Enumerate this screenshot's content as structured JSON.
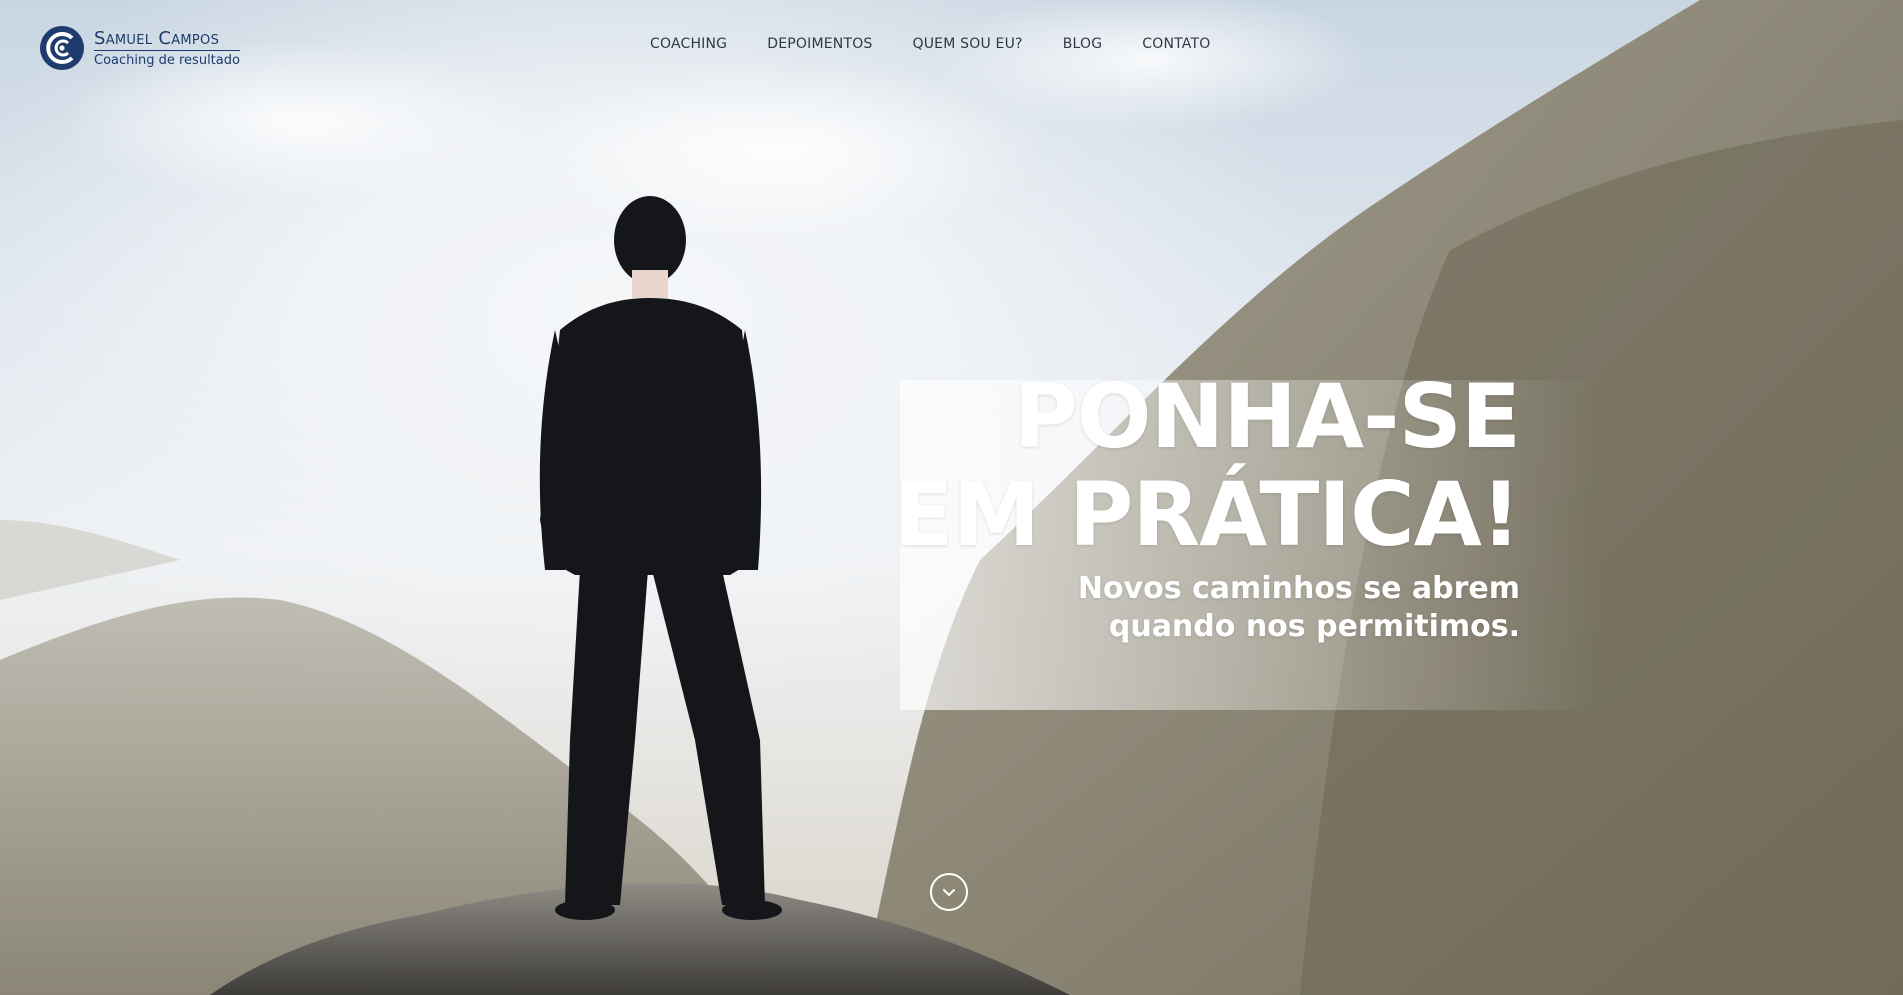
{
  "brand": {
    "name": "Samuel Campos",
    "tagline": "Coaching de resultado",
    "logo_icon": "concentric-c-logo-icon",
    "color": "#1d3b6c"
  },
  "nav": {
    "items": [
      {
        "label": "COACHING"
      },
      {
        "label": "DEPOIMENTOS"
      },
      {
        "label": "QUEM SOU EU?"
      },
      {
        "label": "BLOG"
      },
      {
        "label": "CONTATO"
      }
    ]
  },
  "hero": {
    "title_line1": "PONHA-SE",
    "title_line2": "EM PRÁTICA!",
    "subtitle_line1": "Novos caminhos se abrem",
    "subtitle_line2": "quando nos permitimos.",
    "scroll_icon": "chevron-down-icon",
    "text_color": "#ffffff"
  }
}
